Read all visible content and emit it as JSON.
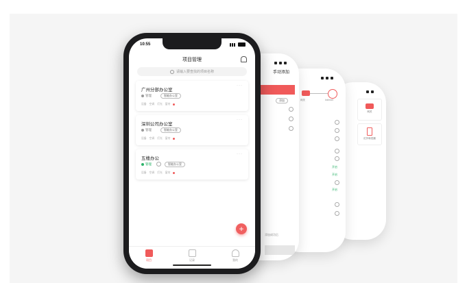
{
  "front": {
    "status": {
      "time": "10:55"
    },
    "app_title": "项目管理",
    "search": {
      "placeholder": "请输入要查找的项目名称"
    },
    "projects": [
      {
        "name": "广州分部办公室",
        "role": "管理",
        "tag": "智能办公室",
        "meta": [
          "设备",
          "空调",
          "灯光",
          "窗帘"
        ],
        "active": false
      },
      {
        "name": "深圳公司办公室",
        "role": "管理",
        "tag": "智能办公室",
        "meta": [
          "设备",
          "空调",
          "灯光",
          "窗帘"
        ],
        "active": false
      },
      {
        "name": "五楼办公",
        "role": "管理",
        "tag": "智能办公室",
        "meta": [
          "设备",
          "空调",
          "灯光",
          "窗帘"
        ],
        "active": true
      }
    ],
    "fab_label": "+",
    "tabs": [
      "项目",
      "记录",
      "我的"
    ]
  },
  "back1": {
    "title": "手动添加",
    "button": "添加",
    "bottom_hint": "添加成功后"
  },
  "back2": {
    "labels": [
      "网关",
      "Internet"
    ],
    "green": [
      "开启",
      "开启",
      "开启"
    ]
  },
  "back3": {
    "items": [
      "网关",
      "红外转发器"
    ]
  },
  "colors": {
    "accent": "#f05a5a",
    "green": "#2db36a"
  }
}
